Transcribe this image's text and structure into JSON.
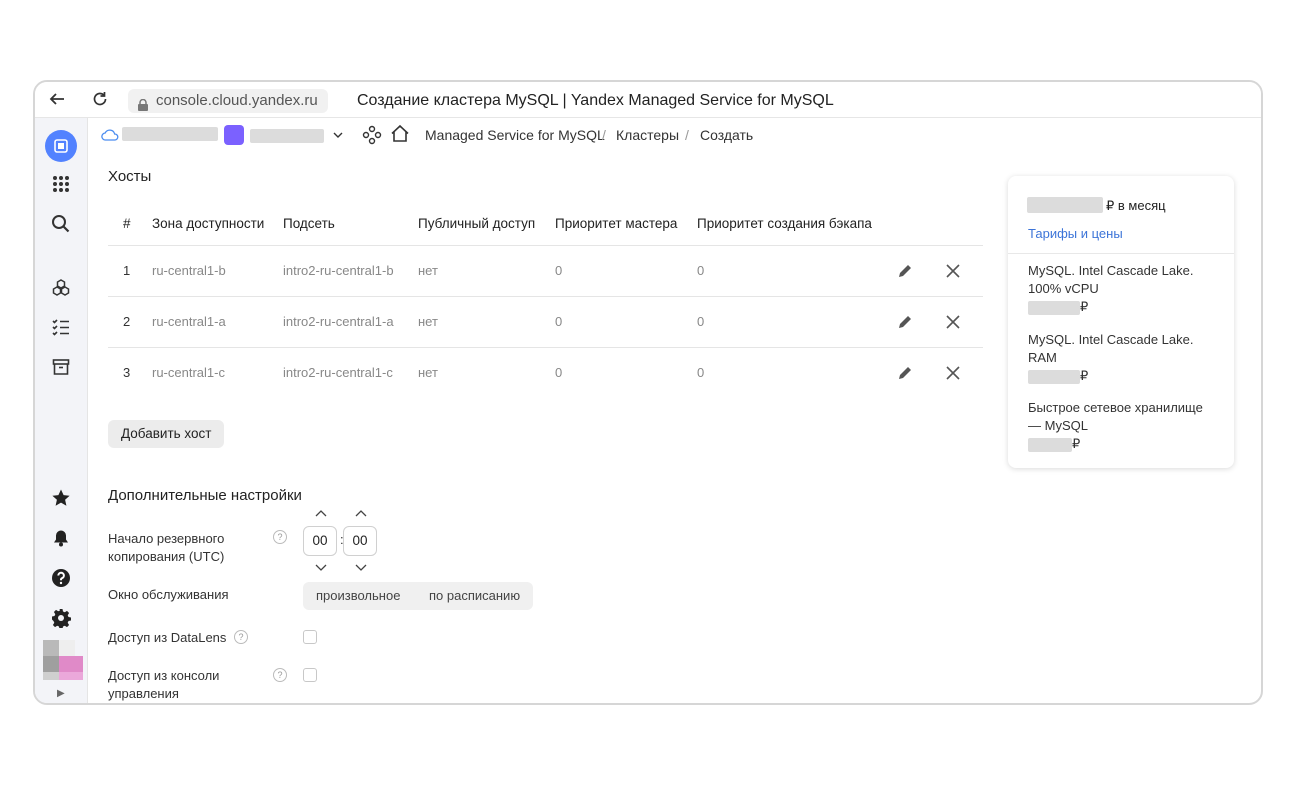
{
  "browser": {
    "url": "console.cloud.yandex.ru",
    "title": "Создание кластера MySQL | Yandex Managed Service for MySQL"
  },
  "breadcrumbs": {
    "service": "Managed Service for MySQL",
    "clusters": "Кластеры",
    "create": "Создать",
    "separator": "/"
  },
  "hosts": {
    "title": "Хосты",
    "columns": [
      "#",
      "Зона доступности",
      "Подсеть",
      "Публичный доступ",
      "Приоритет мастера",
      "Приоритет создания бэкапа"
    ],
    "rows": [
      {
        "num": "1",
        "zone": "ru-central1-b",
        "subnet": "intro2-ru-central1-b",
        "public": "нет",
        "master": "0",
        "backup": "0"
      },
      {
        "num": "2",
        "zone": "ru-central1-a",
        "subnet": "intro2-ru-central1-a",
        "public": "нет",
        "master": "0",
        "backup": "0"
      },
      {
        "num": "3",
        "zone": "ru-central1-c",
        "subnet": "intro2-ru-central1-c",
        "public": "нет",
        "master": "0",
        "backup": "0"
      }
    ],
    "add_button": "Добавить хост"
  },
  "extra": {
    "title": "Дополнительные настройки",
    "backup_label_1": "Начало резервного",
    "backup_label_2": "копирования (UTC)",
    "hours": "00",
    "minutes": "00",
    "time_sep": ":",
    "maintenance_label": "Окно обслуживания",
    "maintenance_options": [
      "произвольное",
      "по расписанию"
    ],
    "datalens_label": "Доступ из DataLens",
    "console_label_1": "Доступ из консоли",
    "console_label_2": "управления",
    "help_glyph": "?"
  },
  "price": {
    "per_month": "₽ в месяц",
    "tariffs_link": "Тарифы и цены",
    "items": [
      {
        "line1": "MySQL. Intel Cascade Lake.",
        "line2": "100% vCPU",
        "currency": "₽"
      },
      {
        "line1": "MySQL. Intel Cascade Lake.",
        "line2": "RAM",
        "currency": "₽"
      },
      {
        "line1": "Быстрое сетевое хранилище",
        "line2": "— MySQL",
        "currency": "₽"
      }
    ]
  },
  "colors": {
    "accent": "#5282ff",
    "link": "#3c74d8",
    "folder": "#7b61ff"
  }
}
